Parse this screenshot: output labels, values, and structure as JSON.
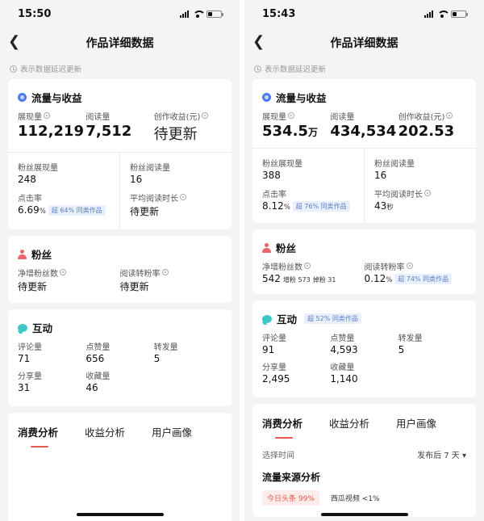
{
  "left": {
    "status": {
      "time": "15:50"
    },
    "nav": {
      "back_icon": "chevron-left",
      "title": "作品详细数据"
    },
    "notice": "表示数据延迟更新",
    "traffic": {
      "title": "流量与收益",
      "impressions_label": "展现量",
      "impressions": "112,219",
      "reads_label": "阅读量",
      "reads": "7,512",
      "income_label": "创作收益(元)",
      "income": "待更新",
      "fan_impr_label": "粉丝展现量",
      "fan_impr": "248",
      "fan_reads_label": "粉丝阅读量",
      "fan_reads": "16",
      "ctr_label": "点击率",
      "ctr": "6.69",
      "ctr_unit": "%",
      "ctr_tag": "超 64% 同类作品",
      "avg_time_label": "平均阅读时长",
      "avg_time": "待更新"
    },
    "fans": {
      "title": "粉丝",
      "net_label": "净增粉丝数",
      "net": "待更新",
      "conv_label": "阅读转粉率",
      "conv": "待更新"
    },
    "interact": {
      "title": "互动",
      "comments_label": "评论量",
      "comments": "71",
      "likes_label": "点赞量",
      "likes": "656",
      "reposts_label": "转发量",
      "reposts": "5",
      "shares_label": "分享量",
      "shares": "31",
      "favs_label": "收藏量",
      "favs": "46"
    },
    "tabs": [
      "消费分析",
      "收益分析",
      "用户画像"
    ]
  },
  "right": {
    "status": {
      "time": "15:43"
    },
    "nav": {
      "back_icon": "chevron-left",
      "title": "作品详细数据"
    },
    "notice": "表示数据延迟更新",
    "traffic": {
      "title": "流量与收益",
      "impressions_label": "展现量",
      "impressions": "534.5",
      "impressions_unit": "万",
      "reads_label": "阅读量",
      "reads": "434,534",
      "income_label": "创作收益(元)",
      "income": "202.53",
      "fan_impr_label": "粉丝展现量",
      "fan_impr": "388",
      "fan_reads_label": "粉丝阅读量",
      "fan_reads": "16",
      "ctr_label": "点击率",
      "ctr": "8.12",
      "ctr_unit": "%",
      "ctr_tag": "超 76% 同类作品",
      "avg_time_label": "平均阅读时长",
      "avg_time": "43",
      "avg_time_unit": "秒"
    },
    "fans": {
      "title": "粉丝",
      "net_label": "净增粉丝数",
      "net": "542",
      "net_gain": "增粉 573",
      "net_loss": "掉粉 31",
      "conv_label": "阅读转粉率",
      "conv": "0.12",
      "conv_unit": "%",
      "conv_tag": "超 74% 同类作品"
    },
    "interact": {
      "title": "互动",
      "title_tag": "超 52% 同类作品",
      "comments_label": "评论量",
      "comments": "91",
      "likes_label": "点赞量",
      "likes": "4,593",
      "reposts_label": "转发量",
      "reposts": "5",
      "shares_label": "分享量",
      "shares": "2,495",
      "favs_label": "收藏量",
      "favs": "1,140"
    },
    "tabs": [
      "消费分析",
      "收益分析",
      "用户画像"
    ],
    "filter": {
      "label": "选择时间",
      "value": "发布后 7 天 ▾"
    },
    "source": {
      "title": "流量来源分析",
      "chip1": "今日头条 99%",
      "chip2": "西瓜视频 <1%"
    }
  }
}
